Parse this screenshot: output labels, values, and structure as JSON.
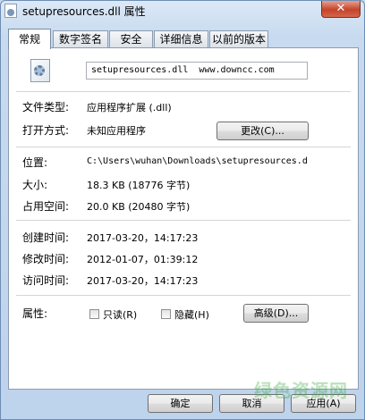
{
  "window": {
    "title": "setupresources.dll 属性",
    "close_label": "✕"
  },
  "tabs": [
    {
      "label": "常规",
      "active": true
    },
    {
      "label": "数字签名",
      "active": false
    },
    {
      "label": "安全",
      "active": false
    },
    {
      "label": "详细信息",
      "active": false
    },
    {
      "label": "以前的版本",
      "active": false
    }
  ],
  "general": {
    "file_name": "setupresources.dll  www.downcc.com",
    "file_type_label": "文件类型:",
    "file_type_value": "应用程序扩展 (.dll)",
    "opens_with_label": "打开方式:",
    "opens_with_value": "未知应用程序",
    "change_button": "更改(C)...",
    "location_label": "位置:",
    "location_value": "C:\\Users\\wuhan\\Downloads\\setupresources.d",
    "size_label": "大小:",
    "size_value": "18.3 KB (18776 字节)",
    "size_on_disk_label": "占用空间:",
    "size_on_disk_value": "20.0 KB (20480 字节)",
    "created_label": "创建时间:",
    "created_value": "2017-03-20，14:17:23",
    "modified_label": "修改时间:",
    "modified_value": "2012-01-07，01:39:12",
    "accessed_label": "访问时间:",
    "accessed_value": "2017-03-20，14:17:23",
    "attributes_label": "属性:",
    "readonly_label": "只读(R)",
    "hidden_label": "隐藏(H)",
    "advanced_button": "高级(D)..."
  },
  "footer": {
    "ok": "确定",
    "cancel": "取消",
    "apply": "应用(A)"
  },
  "watermark": "绿色资源网",
  "icons": {
    "app": "file-icon",
    "dll": "gear-file-icon",
    "close": "close-icon"
  }
}
